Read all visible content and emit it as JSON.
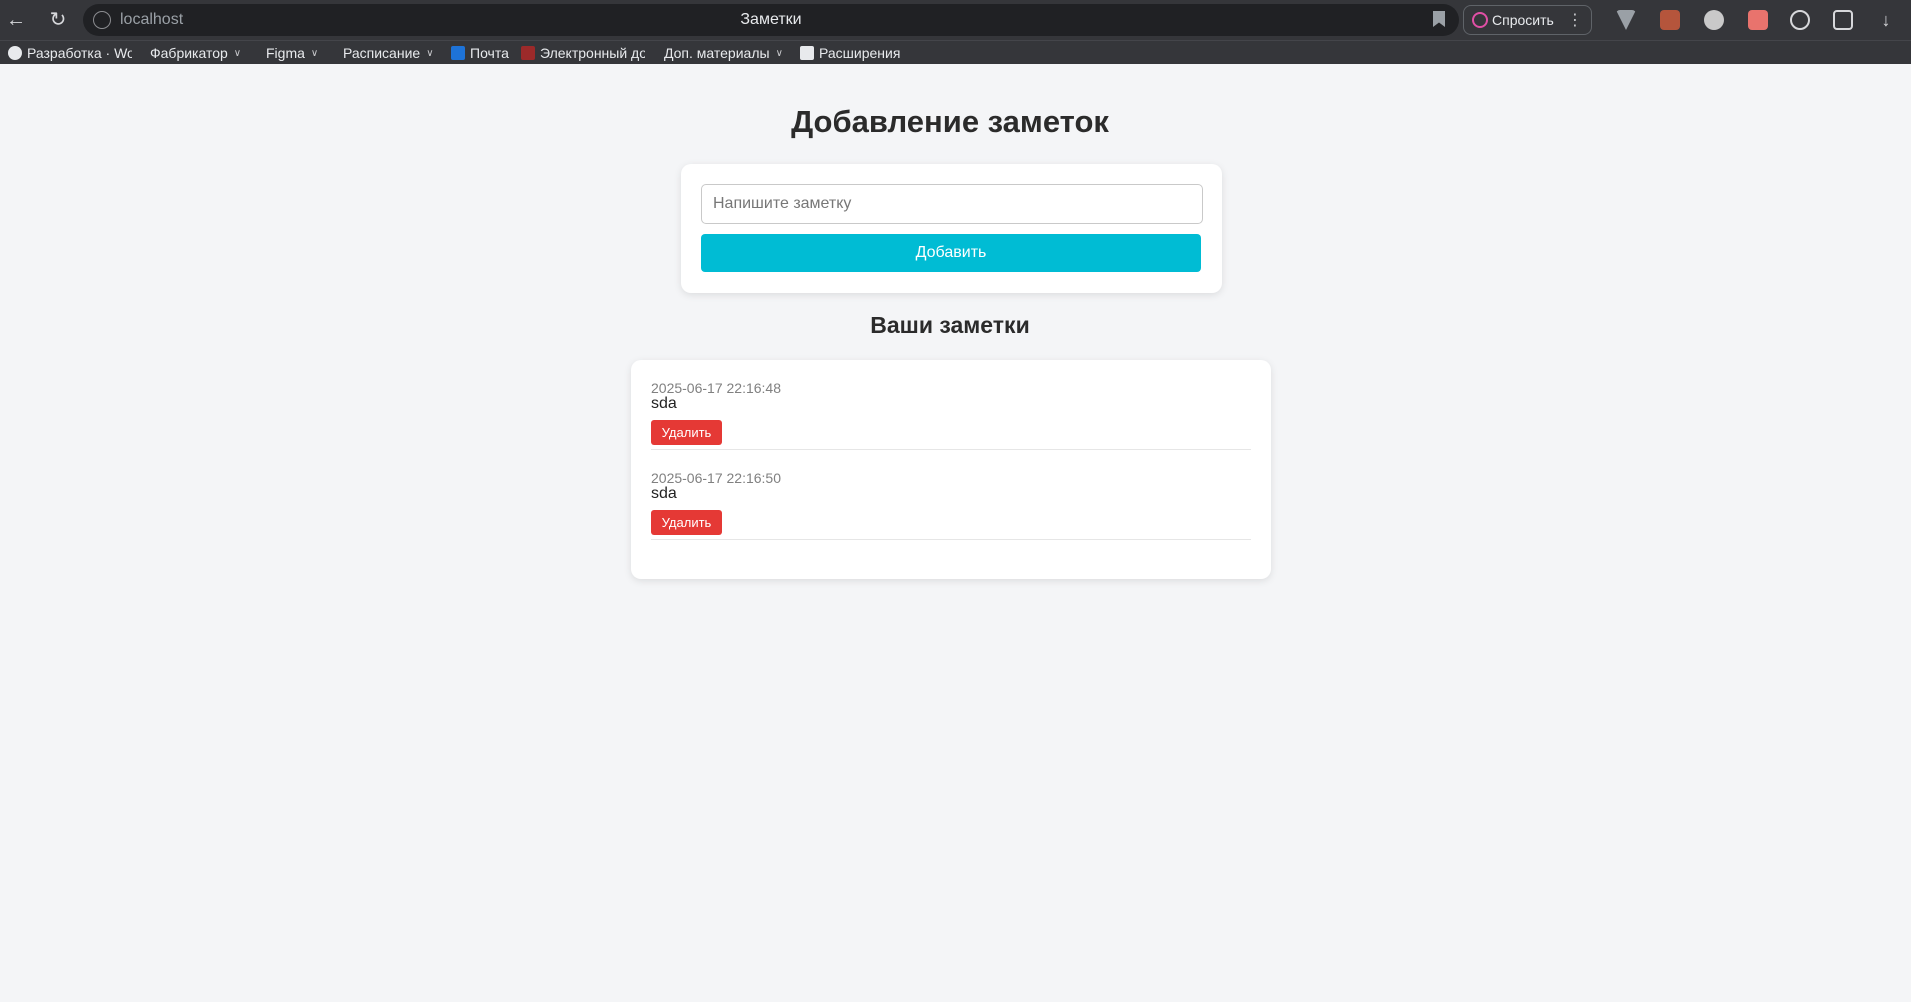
{
  "browser": {
    "url": "localhost",
    "tab_title": "Заметки",
    "ask_label": "Спросить",
    "bookmarks": [
      {
        "label": "Разработка · Worl",
        "has_menu": false
      },
      {
        "label": "Фабрикатор",
        "has_menu": true
      },
      {
        "label": "Figma",
        "has_menu": true
      },
      {
        "label": "Расписание",
        "has_menu": true
      },
      {
        "label": "Почта",
        "has_menu": false
      },
      {
        "label": "Электронный док",
        "has_menu": false
      },
      {
        "label": "Доп. материалы",
        "has_menu": true
      },
      {
        "label": "Расширения",
        "has_menu": false
      }
    ],
    "icons": [
      "back-arrow-icon",
      "reload-icon",
      "site-info-icon",
      "bookmark-star-icon",
      "ask-icon",
      "more-icon",
      "extension-icons",
      "download-icon"
    ]
  },
  "page": {
    "title": "Добавление заметок",
    "input_placeholder": "Напишите заметку",
    "add_label": "Добавить",
    "list_title": "Ваши заметки",
    "accent_color": "#00bcd4",
    "delete_color": "#e53935"
  },
  "notes": [
    {
      "timestamp": "2025-06-17 22:16:48",
      "text": "sda",
      "delete_label": "Удалить"
    },
    {
      "timestamp": "2025-06-17 22:16:50",
      "text": "sda",
      "delete_label": "Удалить"
    }
  ]
}
